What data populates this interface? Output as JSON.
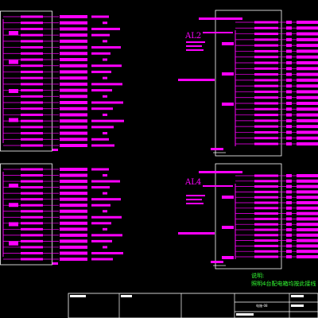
{
  "panels": [
    {
      "title": "AL2"
    },
    {
      "title": "AL4"
    }
  ],
  "note": {
    "heading": "说明:",
    "text": "照明4台配电箱均按此接线"
  },
  "title_block": {
    "drawing_no": "电施-08"
  },
  "colors": {
    "background": "#000000",
    "feeder": "#ff00ff",
    "frame": "#ffffff",
    "note": "#33ff33",
    "title_fill": "#ffffff"
  }
}
